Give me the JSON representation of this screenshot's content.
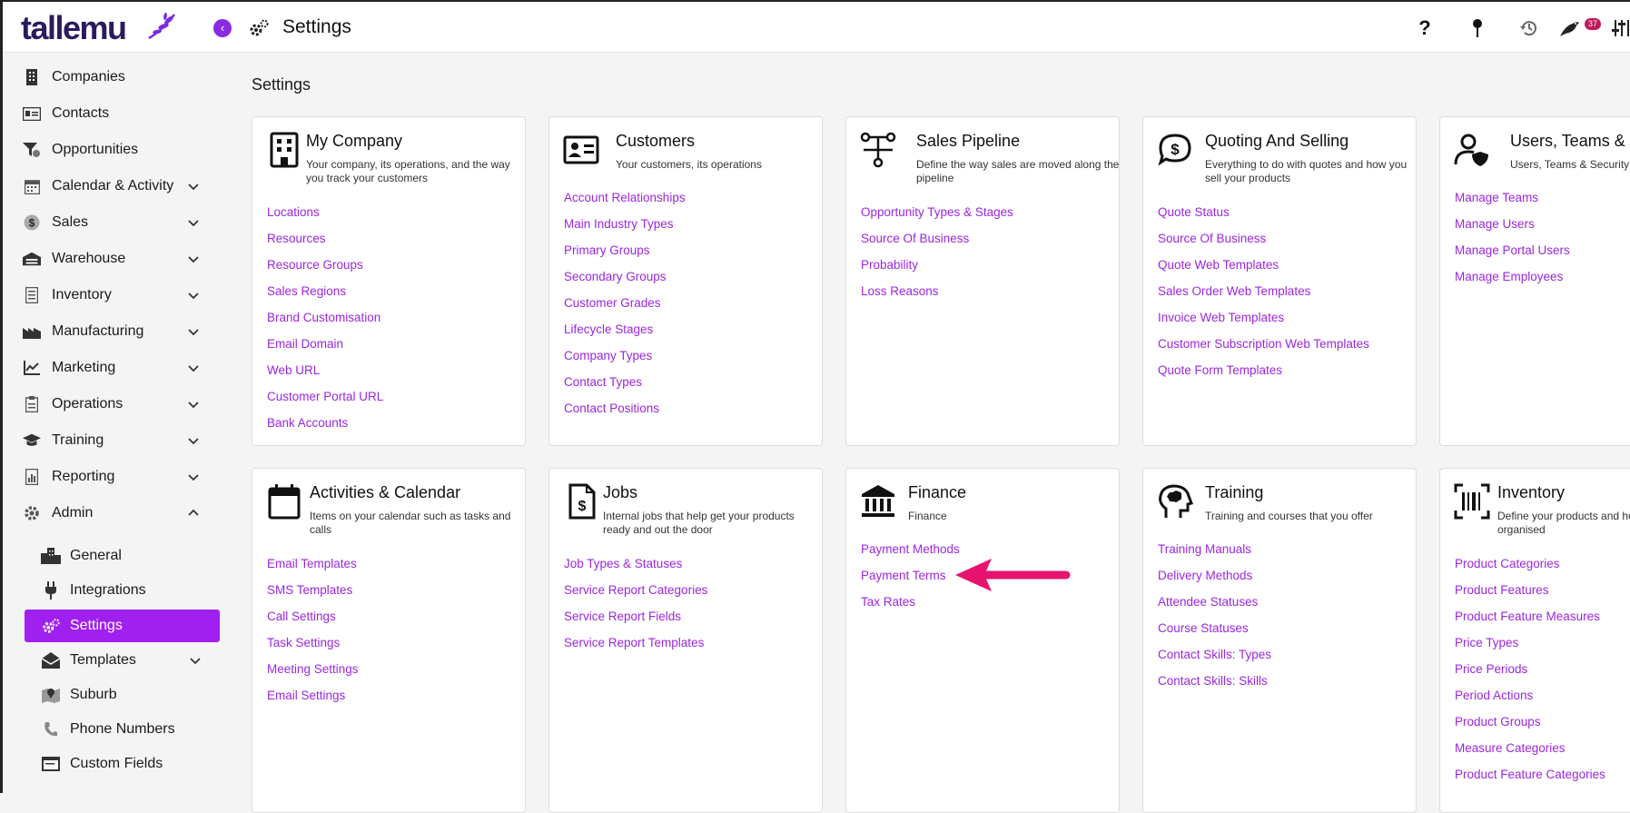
{
  "brand": {
    "logo_text": "tallemu"
  },
  "topbar": {
    "title": "Settings",
    "icons": [
      "help-icon",
      "pin-icon",
      "history-icon",
      "bird-notification-icon",
      "sliders-icon"
    ],
    "notification_count": "37"
  },
  "sidebar": {
    "items": [
      {
        "label": "Companies",
        "icon": "building-icon"
      },
      {
        "label": "Contacts",
        "icon": "contact-card-icon"
      },
      {
        "label": "Opportunities",
        "icon": "funnel-icon"
      },
      {
        "label": "Calendar & Activity",
        "icon": "calendar-icon"
      },
      {
        "label": "Sales",
        "icon": "dollar-icon"
      },
      {
        "label": "Warehouse",
        "icon": "warehouse-icon"
      },
      {
        "label": "Inventory",
        "icon": "clipboard-list-icon"
      },
      {
        "label": "Manufacturing",
        "icon": "factory-icon"
      },
      {
        "label": "Marketing",
        "icon": "trend-chart-icon"
      },
      {
        "label": "Operations",
        "icon": "clipboard-icon"
      },
      {
        "label": "Training",
        "icon": "graduation-cap-icon"
      },
      {
        "label": "Reporting",
        "icon": "report-icon"
      },
      {
        "label": "Admin",
        "icon": "gear-icon"
      }
    ],
    "admin_sub": [
      {
        "label": "General",
        "icon": "city-icon"
      },
      {
        "label": "Integrations",
        "icon": "plug-icon"
      },
      {
        "label": "Settings",
        "icon": "gears-icon"
      },
      {
        "label": "Templates",
        "icon": "envelope-open-icon"
      },
      {
        "label": "Suburb",
        "icon": "map-pin-icon"
      },
      {
        "label": "Phone Numbers",
        "icon": "phone-icon"
      },
      {
        "label": "Custom Fields",
        "icon": "window-icon"
      }
    ]
  },
  "main": {
    "title": "Settings",
    "cards": [
      {
        "title": "My Company",
        "icon": "building-icon",
        "desc": "Your company, its operations, and the way you track your customers",
        "links": [
          "Locations",
          "Resources",
          "Resource Groups",
          "Sales Regions",
          "Brand Customisation",
          "Email Domain",
          "Web URL",
          "Customer Portal URL",
          "Bank Accounts"
        ]
      },
      {
        "title": "Customers",
        "icon": "contact-card-icon",
        "desc": "Your customers, its operations",
        "links": [
          "Account Relationships",
          "Main Industry Types",
          "Primary Groups",
          "Secondary Groups",
          "Customer Grades",
          "Lifecycle Stages",
          "Company Types",
          "Contact Types",
          "Contact Positions"
        ]
      },
      {
        "title": "Sales Pipeline",
        "icon": "pipeline-icon",
        "desc": "Define the way sales are moved along the pipeline",
        "links": [
          "Opportunity Types & Stages",
          "Source Of Business",
          "Probability",
          "Loss Reasons"
        ]
      },
      {
        "title": "Quoting And Selling",
        "icon": "dollar-chat-icon",
        "desc": "Everything to do with quotes and how you sell your products",
        "links": [
          "Quote Status",
          "Source Of Business",
          "Quote Web Templates",
          "Sales Order Web Templates",
          "Invoice Web Templates",
          "Customer Subscription Web Templates",
          "Quote Form Templates"
        ]
      },
      {
        "title": "Users, Teams & Security",
        "icon": "user-shield-icon",
        "desc": "Users, Teams & Security",
        "links": [
          "Manage Teams",
          "Manage Users",
          "Manage Portal Users",
          "Manage Employees"
        ]
      },
      {
        "title": "Activities & Calendar",
        "icon": "calendar-icon",
        "desc": "Items on your calendar such as tasks and calls",
        "links": [
          "Email Templates",
          "SMS Templates",
          "Call Settings",
          "Task Settings",
          "Meeting Settings",
          "Email Settings"
        ]
      },
      {
        "title": "Jobs",
        "icon": "invoice-dollar-icon",
        "desc": "Internal jobs that help get your products ready and out the door",
        "links": [
          "Job Types & Statuses",
          "Service Report Categories",
          "Service Report Fields",
          "Service Report Templates"
        ]
      },
      {
        "title": "Finance",
        "icon": "bank-icon",
        "desc": "Finance",
        "links": [
          "Payment Methods",
          "Payment Terms",
          "Tax Rates"
        ]
      },
      {
        "title": "Training",
        "icon": "brain-head-icon",
        "desc": "Training and courses that you offer",
        "links": [
          "Training Manuals",
          "Delivery Methods",
          "Attendee Statuses",
          "Course Statuses",
          "Contact Skills: Types",
          "Contact Skills: Skills"
        ]
      },
      {
        "title": "Inventory",
        "icon": "barcode-scan-icon",
        "desc": "Define your products and how they are organised",
        "links": [
          "Product Categories",
          "Product Features",
          "Product Feature Measures",
          "Price Types",
          "Price Periods",
          "Period Actions",
          "Product Groups",
          "Measure Categories",
          "Product Feature Categories"
        ]
      }
    ]
  },
  "colors": {
    "accent": "#a020f0",
    "link": "#9b26e0",
    "arrow": "#e8126f",
    "logo": "#2b1b5e"
  }
}
